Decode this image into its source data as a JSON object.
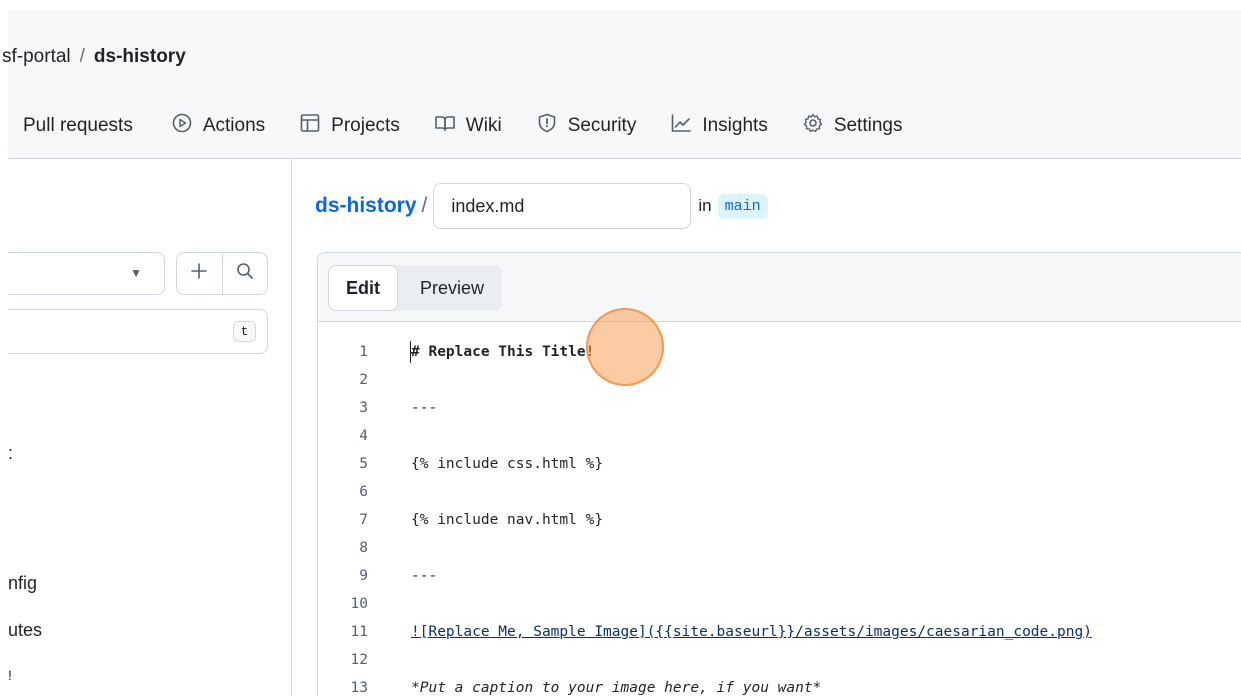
{
  "header": {
    "breadcrumb": {
      "owner": "sf-portal",
      "separator": "/",
      "repo": "ds-history"
    },
    "tabs": [
      {
        "label": "Pull requests",
        "icon": "pull-request-icon"
      },
      {
        "label": "Actions",
        "icon": "play-icon"
      },
      {
        "label": "Projects",
        "icon": "table-icon"
      },
      {
        "label": "Wiki",
        "icon": "book-icon"
      },
      {
        "label": "Security",
        "icon": "shield-icon"
      },
      {
        "label": "Insights",
        "icon": "graph-icon"
      },
      {
        "label": "Settings",
        "icon": "gear-icon"
      }
    ]
  },
  "sidebar": {
    "filter_shortcut": "t",
    "tree_items": [
      ":",
      "nfig",
      "utes",
      "!"
    ]
  },
  "editor": {
    "path_repo": "ds-history",
    "path_separator": "/",
    "filename": "index.md",
    "in_label": "in",
    "branch": "main",
    "tabs": {
      "edit": "Edit",
      "preview": "Preview"
    },
    "lines": [
      {
        "n": "1",
        "text": "# Replace This Title!",
        "style": "bold"
      },
      {
        "n": "2",
        "text": "",
        "style": ""
      },
      {
        "n": "3",
        "text": "---",
        "style": ""
      },
      {
        "n": "4",
        "text": "",
        "style": ""
      },
      {
        "n": "5",
        "text": "{% include css.html %}",
        "style": ""
      },
      {
        "n": "6",
        "text": "",
        "style": ""
      },
      {
        "n": "7",
        "text": "{% include nav.html %}",
        "style": ""
      },
      {
        "n": "8",
        "text": "",
        "style": ""
      },
      {
        "n": "9",
        "text": "---",
        "style": ""
      },
      {
        "n": "10",
        "text": "",
        "style": ""
      },
      {
        "n": "11",
        "text": "![Replace Me, Sample Image]({{site.baseurl}}/assets/images/caesarian_code.png)",
        "style": "link"
      },
      {
        "n": "12",
        "text": "",
        "style": ""
      },
      {
        "n": "13",
        "text": "*Put a caption to your image here, if you want*",
        "style": "italic"
      }
    ]
  },
  "colors": {
    "accent": "#0969da",
    "border": "#d0d7de",
    "header_bg": "#f6f8fa",
    "click_marker": "#f7a05a"
  }
}
